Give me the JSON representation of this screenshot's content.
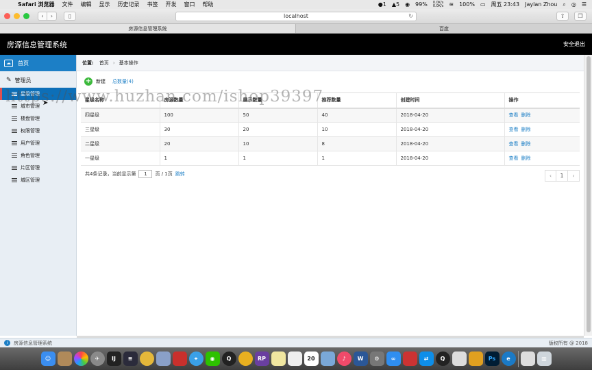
{
  "menubar": {
    "app_name": "Safari 浏览器",
    "items": [
      "文件",
      "编辑",
      "显示",
      "历史记录",
      "书签",
      "开发",
      "窗口",
      "帮助"
    ],
    "status": {
      "badge_1": "1",
      "badge_2": "5",
      "net_up": "0.0K/s",
      "net_down": "0.0K/s",
      "battery": "100%",
      "datetime": "周五 23:43",
      "user": "Jaylan Zhou",
      "stat_pct": "99%"
    }
  },
  "browser": {
    "url": "localhost",
    "tabs": [
      "房源信息管理系统",
      "百度"
    ]
  },
  "header": {
    "title": "房源信息管理系统",
    "logout": "安全退出"
  },
  "sidebar": {
    "home": "首页",
    "group": "管理员",
    "items": [
      "星级管理",
      "城市管理",
      "楼盘管理",
      "权限管理",
      "用户管理",
      "角色管理",
      "片区管理",
      "城区管理"
    ]
  },
  "breadcrumb": {
    "label": "位置:",
    "home": "首页",
    "current": "基本操作"
  },
  "actions": {
    "new": "新建",
    "total": "总数量(4)"
  },
  "table": {
    "columns": [
      "星级名称",
      "房源数量",
      "展示数量",
      "推荐数量",
      "创建时间",
      "操作"
    ],
    "rows": [
      {
        "name": "四星级",
        "houses": "100",
        "shown": "50",
        "recommend": "40",
        "created": "2018-04-20"
      },
      {
        "name": "三星级",
        "houses": "30",
        "shown": "20",
        "recommend": "10",
        "created": "2018-04-20"
      },
      {
        "name": "二星级",
        "houses": "20",
        "shown": "10",
        "recommend": "8",
        "created": "2018-04-20"
      },
      {
        "name": "一星级",
        "houses": "1",
        "shown": "1",
        "recommend": "1",
        "created": "2018-04-20"
      }
    ],
    "view": "查看",
    "delete": "删除"
  },
  "pager": {
    "summary": "共4条记录，当前显示第",
    "page_value": "1",
    "suffix": "页 / 1页",
    "jump": "跳转",
    "prev": "‹",
    "current": "1",
    "next": "›"
  },
  "status": {
    "left": "房源信息管理系统",
    "right": "版权所有 @ 2018"
  },
  "watermark": "https://www.huzhan.com/ishop39397",
  "dock": [
    "Finder",
    "Notes",
    "Photos",
    "Launchpad",
    "IJ",
    "Sublime",
    "Mail",
    "DB",
    "Redis",
    "Safari",
    "WeChat",
    "QQ",
    "Chrome",
    "RP",
    "Stickies",
    "Notes2",
    "20",
    "Preview",
    "Music",
    "W",
    "Prefs",
    "Baidu",
    "Dict",
    "Team",
    "QQ2",
    "Script",
    "Sheets",
    "Ps",
    "Edge",
    "Downloads",
    "Trash"
  ]
}
